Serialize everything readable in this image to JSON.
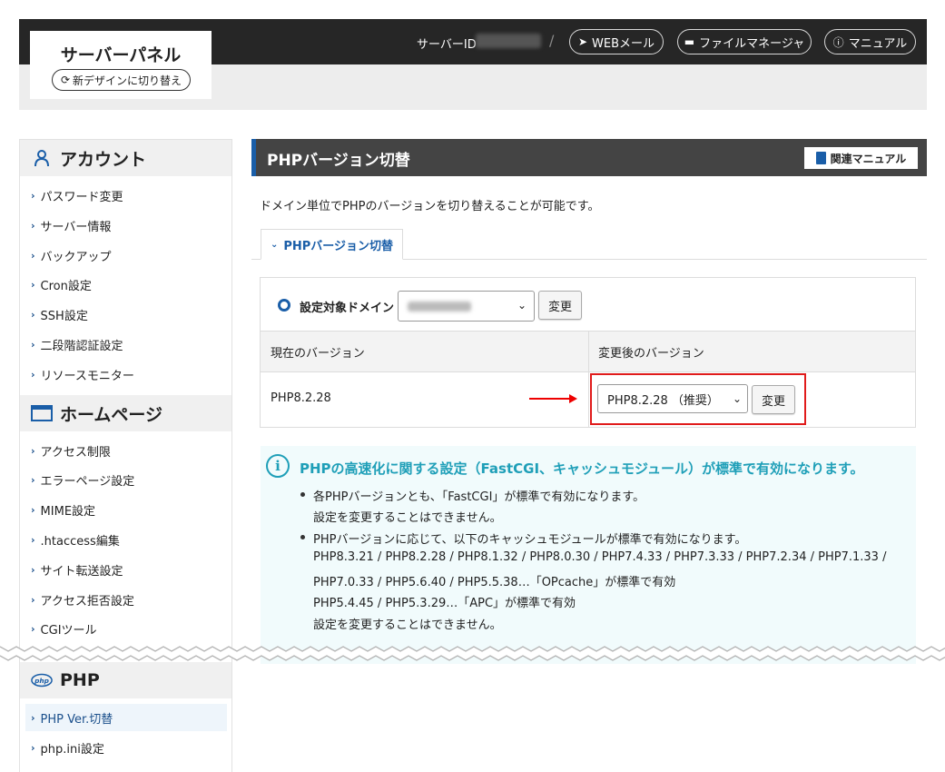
{
  "header": {
    "logo_title": "サーバーパネル",
    "new_design_label": "新デザインに切り替え",
    "server_id_label": "サーバーID",
    "separator": "/",
    "webmail_label": "WEBメール",
    "filemanager_label": "ファイルマネージャ",
    "manual_label": "マニュアル"
  },
  "sidebar": {
    "account": {
      "heading": "アカウント",
      "items": [
        "パスワード変更",
        "サーバー情報",
        "バックアップ",
        "Cron設定",
        "SSH設定",
        "二段階認証設定",
        "リソースモニター"
      ]
    },
    "homepage": {
      "heading": "ホームページ",
      "items": [
        "アクセス制限",
        "エラーページ設定",
        "MIME設定",
        ".htaccess編集",
        "サイト転送設定",
        "アクセス拒否設定",
        "CGIツール"
      ]
    },
    "php": {
      "heading": "PHP",
      "icon_text": "php",
      "items": [
        "PHP Ver.切替",
        "php.ini設定"
      ]
    }
  },
  "main": {
    "title": "PHPバージョン切替",
    "related_manual_label": "関連マニュアル",
    "description": "ドメイン単位でPHPのバージョンを切り替えることが可能です。",
    "tab_label": "PHPバージョン切替",
    "domain_label": "設定対象ドメイン",
    "change_button_label": "変更",
    "col_current": "現在のバージョン",
    "col_new": "変更後のバージョン",
    "current_version": "PHP8.2.28",
    "selected_version": "PHP8.2.28 （推奨）",
    "info": {
      "title": "PHPの高速化に関する設定（FastCGI、キャッシュモジュール）が標準で有効になります。",
      "lines": [
        "各PHPバージョンとも、「FastCGI」が標準で有効になります。",
        "設定を変更することはできません。",
        "PHPバージョンに応じて、以下のキャッシュモジュールが標準で有効になります。",
        "PHP8.3.21 / PHP8.2.28 / PHP8.1.32 / PHP8.0.30 / PHP7.4.33 / PHP7.3.33 / PHP7.2.34 / PHP7.1.33 /",
        "PHP7.0.33 / PHP5.6.40 / PHP5.5.38…「OPcache」が標準で有効",
        "PHP5.4.45 / PHP5.3.29…「APC」が標準で有効",
        "設定を変更することはできません。"
      ]
    }
  },
  "colors": {
    "header_dark": "#262626",
    "accent_blue": "#1a5ea8",
    "info_teal": "#1f9fb8",
    "highlight_red": "#e01b1b"
  }
}
